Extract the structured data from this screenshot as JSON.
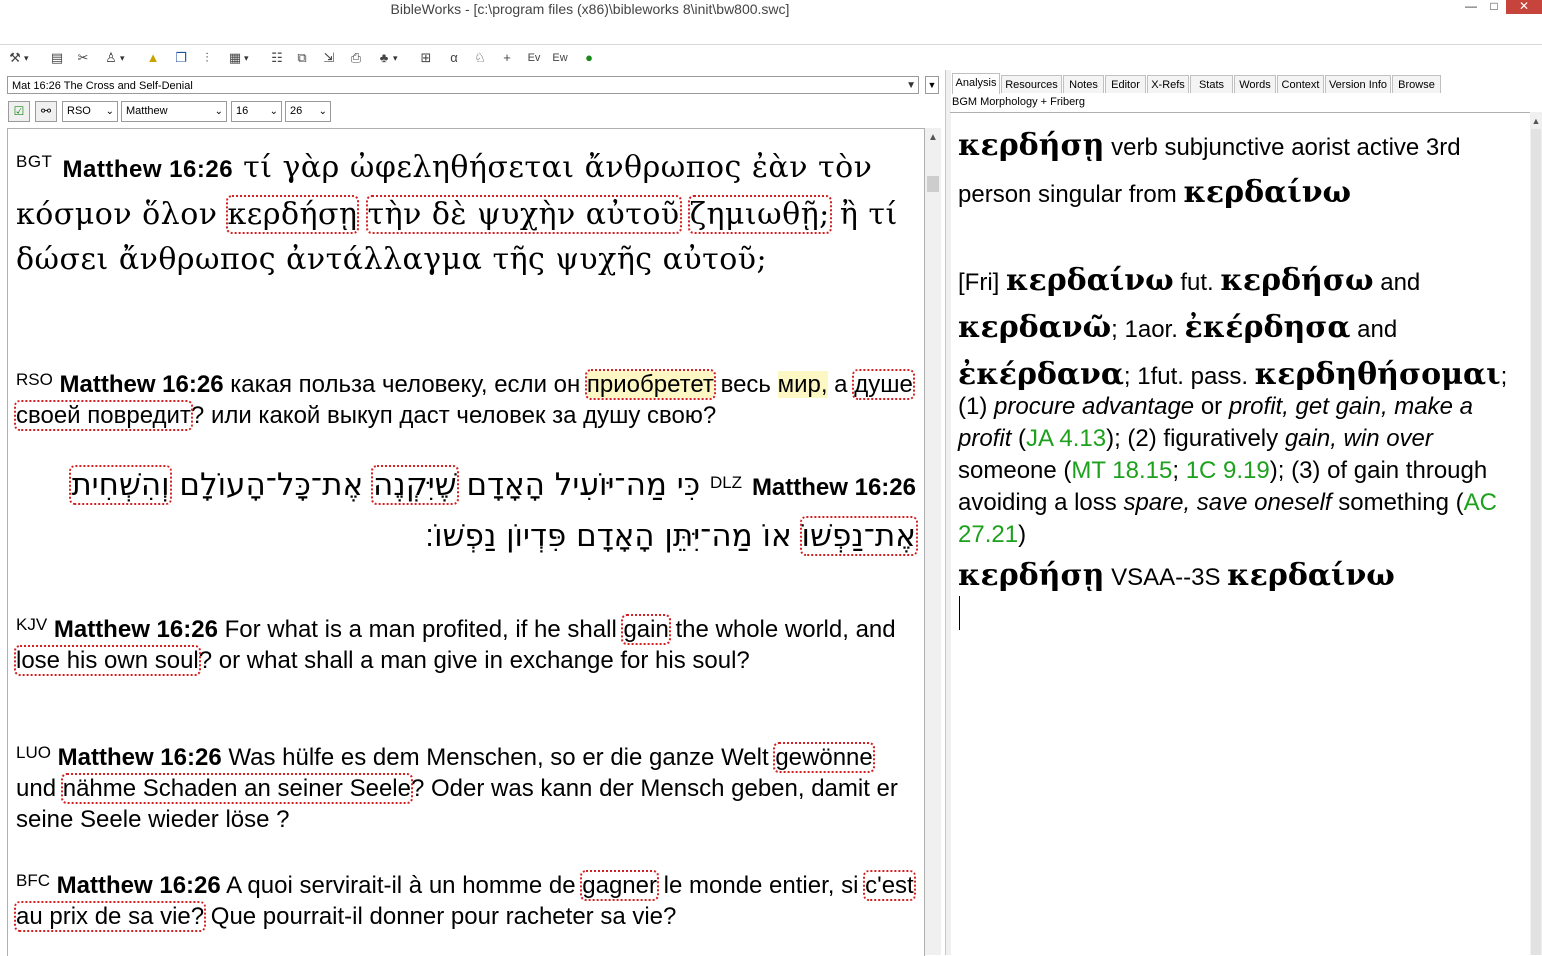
{
  "window": {
    "title": "BibleWorks - [c:\\program files (x86)\\bibleworks 8\\init\\bw800.swc]",
    "minimize": "—",
    "maximize": "□",
    "close": "✕"
  },
  "toolbar": {
    "icons": [
      "search-setup-icon",
      "options-icon",
      "tools-icon",
      "user-icon",
      "highlight-icon",
      "windows-icon",
      "split-icon",
      "layout-icon",
      "columns-icon",
      "copy-icon",
      "export-icon",
      "print-icon",
      "word-list-icon",
      "fullscreen-icon",
      "alphabet-icon",
      "word-icon",
      "plus-icon",
      "ev-icon",
      "ew-icon",
      "globe-icon"
    ]
  },
  "browse": {
    "verse_line": "Mat 16:26 The Cross and Self-Denial",
    "version_select": "RSO",
    "book_select": "Matthew",
    "chapter_select": "16",
    "verse_select": "26"
  },
  "verses": {
    "bgt": {
      "abbr": "BGT",
      "ref": "Matthew 16:26",
      "t1": " τί γὰρ ὠφεληθήσεται ἄνθρωπος ἐὰν τὸν κόσμον ὅλον ",
      "h1": "κερδήσῃ",
      "t2": " ",
      "h2": "τὴν δὲ ψυχὴν αὐτοῦ",
      "t3": " ",
      "h3": "ζημιωθῇ;",
      "t4": " ἢ τί δώσει ἄνθρωπος ἀντάλλαγμα τῆς ψυχῆς αὐτοῦ;"
    },
    "rso": {
      "abbr": "RSO",
      "ref": "Matthew 16:26",
      "t1": " какая польза человеку, если он ",
      "h1": "приобретет",
      "t2": " весь ",
      "y1": "мир,",
      "t3": " а ",
      "h2": "душе своей повредит",
      "t4": "? или какой выкуп даст человек за душу свою?"
    },
    "dlz": {
      "abbr": "DLZ",
      "ref": "Matthew 16:26",
      "t1": "כִּי מַה־יּוֹעִיל הָאָדָם ",
      "h1": "שֶׁיִּקְנֶה",
      "t2": " אֶת־כָּל־הָעוֹלָם ",
      "h2": "וְהִשְׁחִית אֶת־נַפְשׁוֹ",
      "t3": " אוֹ מַה־יִּתֵּן הָאָדָם פִּדְיוֹן נַפְשׁוֹ׃"
    },
    "kjv": {
      "abbr": "KJV",
      "ref": "Matthew 16:26",
      "t1": " For what is a man profited, if he shall ",
      "h1": "gain",
      "t2": " the whole world, and ",
      "h2": "lose his own soul",
      "t3": "? or what shall a man give in exchange for his soul?"
    },
    "luo": {
      "abbr": "LUO",
      "ref": "Matthew 16:26",
      "t1": " Was hülfe es dem Menschen, so er die ganze Welt ",
      "h1": "gewönne",
      "t2": " und ",
      "h2": "nähme Schaden an seiner Seele",
      "t3": "? Oder was kann der Mensch geben, damit er seine Seele wieder löse ?"
    },
    "bfc": {
      "abbr": "BFC",
      "ref": "Matthew 16:26",
      "t1": " A quoi servirait-il à un homme de ",
      "h1": "gagner",
      "t2": " le monde entier, si ",
      "h2": "c'est au prix de sa vie?",
      "t3": " Que pourrait-il donner pour racheter sa vie?"
    }
  },
  "right": {
    "tabs": [
      "Analysis",
      "Resources",
      "Notes",
      "Editor",
      "X-Refs",
      "Stats",
      "Words",
      "Context",
      "Version Info",
      "Browse"
    ],
    "active_tab": "Analysis",
    "label": "BGM Morphology + Friberg",
    "parse": {
      "word": "κερδήσῃ",
      "desc": " verb subjunctive aorist active 3rd person singular from ",
      "lemma": "κερδαίνω"
    },
    "lex": {
      "src": "[Fri] ",
      "lemma": "κερδαίνω",
      "fut_label": " fut. ",
      "fut": "κερδήσω",
      "and1": " and ",
      "alt_fut": "κερδανῶ",
      "aor_label": "; 1aor. ",
      "aor": "ἐκέρδησα",
      "and2": " and ",
      "alt_aor": "ἐκέρδανα",
      "pass_label": "; 1fut. pass. ",
      "pass": "κερδηθήσομαι",
      "semi": ";",
      "d1": "(1) ",
      "i1": "procure advantage",
      "d2": " or ",
      "i2": "profit, get gain, make a profit",
      "d3": " (",
      "r1": "JA 4.13",
      "d4": "); (2) figuratively ",
      "i3": "gain, win over",
      "d5": " someone (",
      "r2": "MT 18.15",
      "d6": "; ",
      "r3": "1C 9.19",
      "d7": "); (3) of gain through avoiding a loss ",
      "i4": "spare, save oneself",
      "d8": " something (",
      "r4": "AC 27.21",
      "d9": ")"
    },
    "morph": {
      "word": "κερδήσῃ",
      "code": " VSAA--3S ",
      "lemma": "κερδαίνω"
    }
  }
}
